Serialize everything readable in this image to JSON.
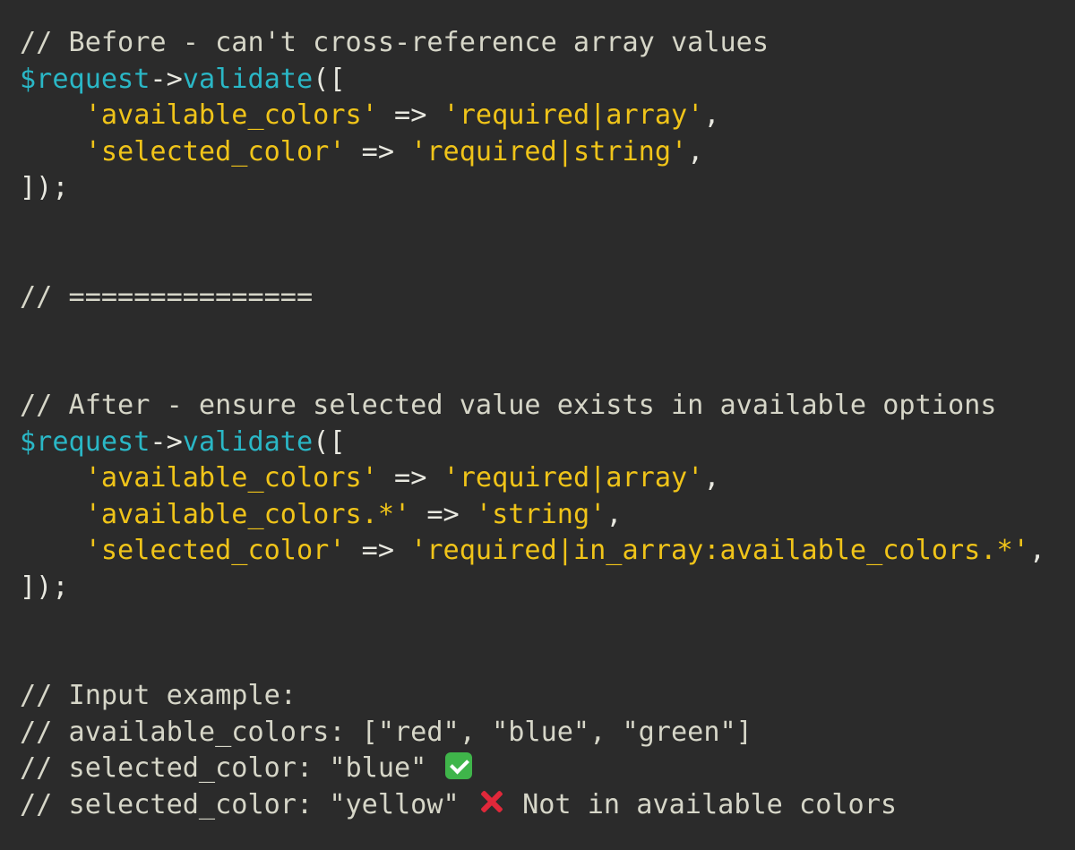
{
  "theme": {
    "background": "#2b2b2b",
    "comment_color": "#d6d6c8",
    "variable_color": "#2ab7c6",
    "string_color": "#f0c419",
    "plain_color": "#e8e8e0",
    "check_color": "#3fb54a",
    "cross_color": "#e0283a"
  },
  "code": {
    "lines": [
      [
        {
          "t": "comment",
          "v": "// Before - can't cross-reference array values"
        }
      ],
      [
        {
          "t": "var",
          "v": "$request"
        },
        {
          "t": "op",
          "v": "->"
        },
        {
          "t": "func",
          "v": "validate"
        },
        {
          "t": "punct",
          "v": "(["
        }
      ],
      [
        {
          "t": "plain",
          "v": "    "
        },
        {
          "t": "string",
          "v": "'available_colors'"
        },
        {
          "t": "op",
          "v": " => "
        },
        {
          "t": "string",
          "v": "'required|array'"
        },
        {
          "t": "punct",
          "v": ","
        }
      ],
      [
        {
          "t": "plain",
          "v": "    "
        },
        {
          "t": "string",
          "v": "'selected_color'"
        },
        {
          "t": "op",
          "v": " => "
        },
        {
          "t": "string",
          "v": "'required|string'"
        },
        {
          "t": "punct",
          "v": ","
        }
      ],
      [
        {
          "t": "punct",
          "v": "]);"
        }
      ],
      [],
      [],
      [
        {
          "t": "comment",
          "v": "// ==============="
        }
      ],
      [],
      [],
      [
        {
          "t": "comment",
          "v": "// After - ensure selected value exists in available options"
        }
      ],
      [
        {
          "t": "var",
          "v": "$request"
        },
        {
          "t": "op",
          "v": "->"
        },
        {
          "t": "func",
          "v": "validate"
        },
        {
          "t": "punct",
          "v": "(["
        }
      ],
      [
        {
          "t": "plain",
          "v": "    "
        },
        {
          "t": "string",
          "v": "'available_colors'"
        },
        {
          "t": "op",
          "v": " => "
        },
        {
          "t": "string",
          "v": "'required|array'"
        },
        {
          "t": "punct",
          "v": ","
        }
      ],
      [
        {
          "t": "plain",
          "v": "    "
        },
        {
          "t": "string",
          "v": "'available_colors.*'"
        },
        {
          "t": "op",
          "v": " => "
        },
        {
          "t": "string",
          "v": "'string'"
        },
        {
          "t": "punct",
          "v": ","
        }
      ],
      [
        {
          "t": "plain",
          "v": "    "
        },
        {
          "t": "string",
          "v": "'selected_color'"
        },
        {
          "t": "op",
          "v": " => "
        },
        {
          "t": "string",
          "v": "'required|in_array:available_colors.*'"
        },
        {
          "t": "punct",
          "v": ","
        }
      ],
      [
        {
          "t": "punct",
          "v": "]);"
        }
      ],
      [],
      [],
      [
        {
          "t": "comment",
          "v": "// Input example:"
        }
      ],
      [
        {
          "t": "comment",
          "v": "// available_colors: [\"red\", \"blue\", \"green\"]"
        }
      ],
      [
        {
          "t": "comment",
          "v": "// selected_color: \"blue\" "
        },
        {
          "t": "icon",
          "v": "check-icon"
        }
      ],
      [
        {
          "t": "comment",
          "v": "// selected_color: \"yellow\" "
        },
        {
          "t": "icon",
          "v": "cross-icon"
        },
        {
          "t": "comment",
          "v": " Not in available colors"
        }
      ]
    ]
  }
}
